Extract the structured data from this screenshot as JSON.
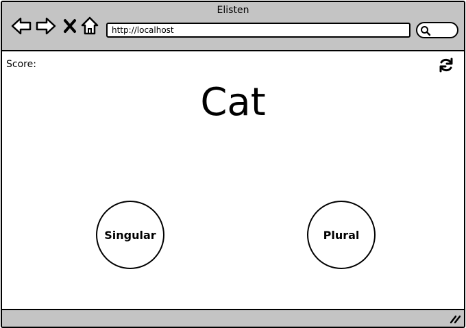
{
  "window": {
    "title": "Elisten"
  },
  "toolbar": {
    "back_icon": "back-arrow-icon",
    "forward_icon": "forward-arrow-icon",
    "stop_icon": "close-icon",
    "home_icon": "home-icon",
    "search_icon": "search-icon"
  },
  "address": {
    "url": "http://localhost"
  },
  "page": {
    "score_label": "Score:",
    "refresh_icon": "refresh-icon",
    "word": "Cat",
    "choices": [
      {
        "label": "Singular"
      },
      {
        "label": "Plural"
      }
    ]
  },
  "statusbar": {
    "resize_icon": "resize-grip-icon"
  },
  "colors": {
    "chrome": "#c4c4c4",
    "ink": "#000000",
    "page": "#ffffff"
  }
}
